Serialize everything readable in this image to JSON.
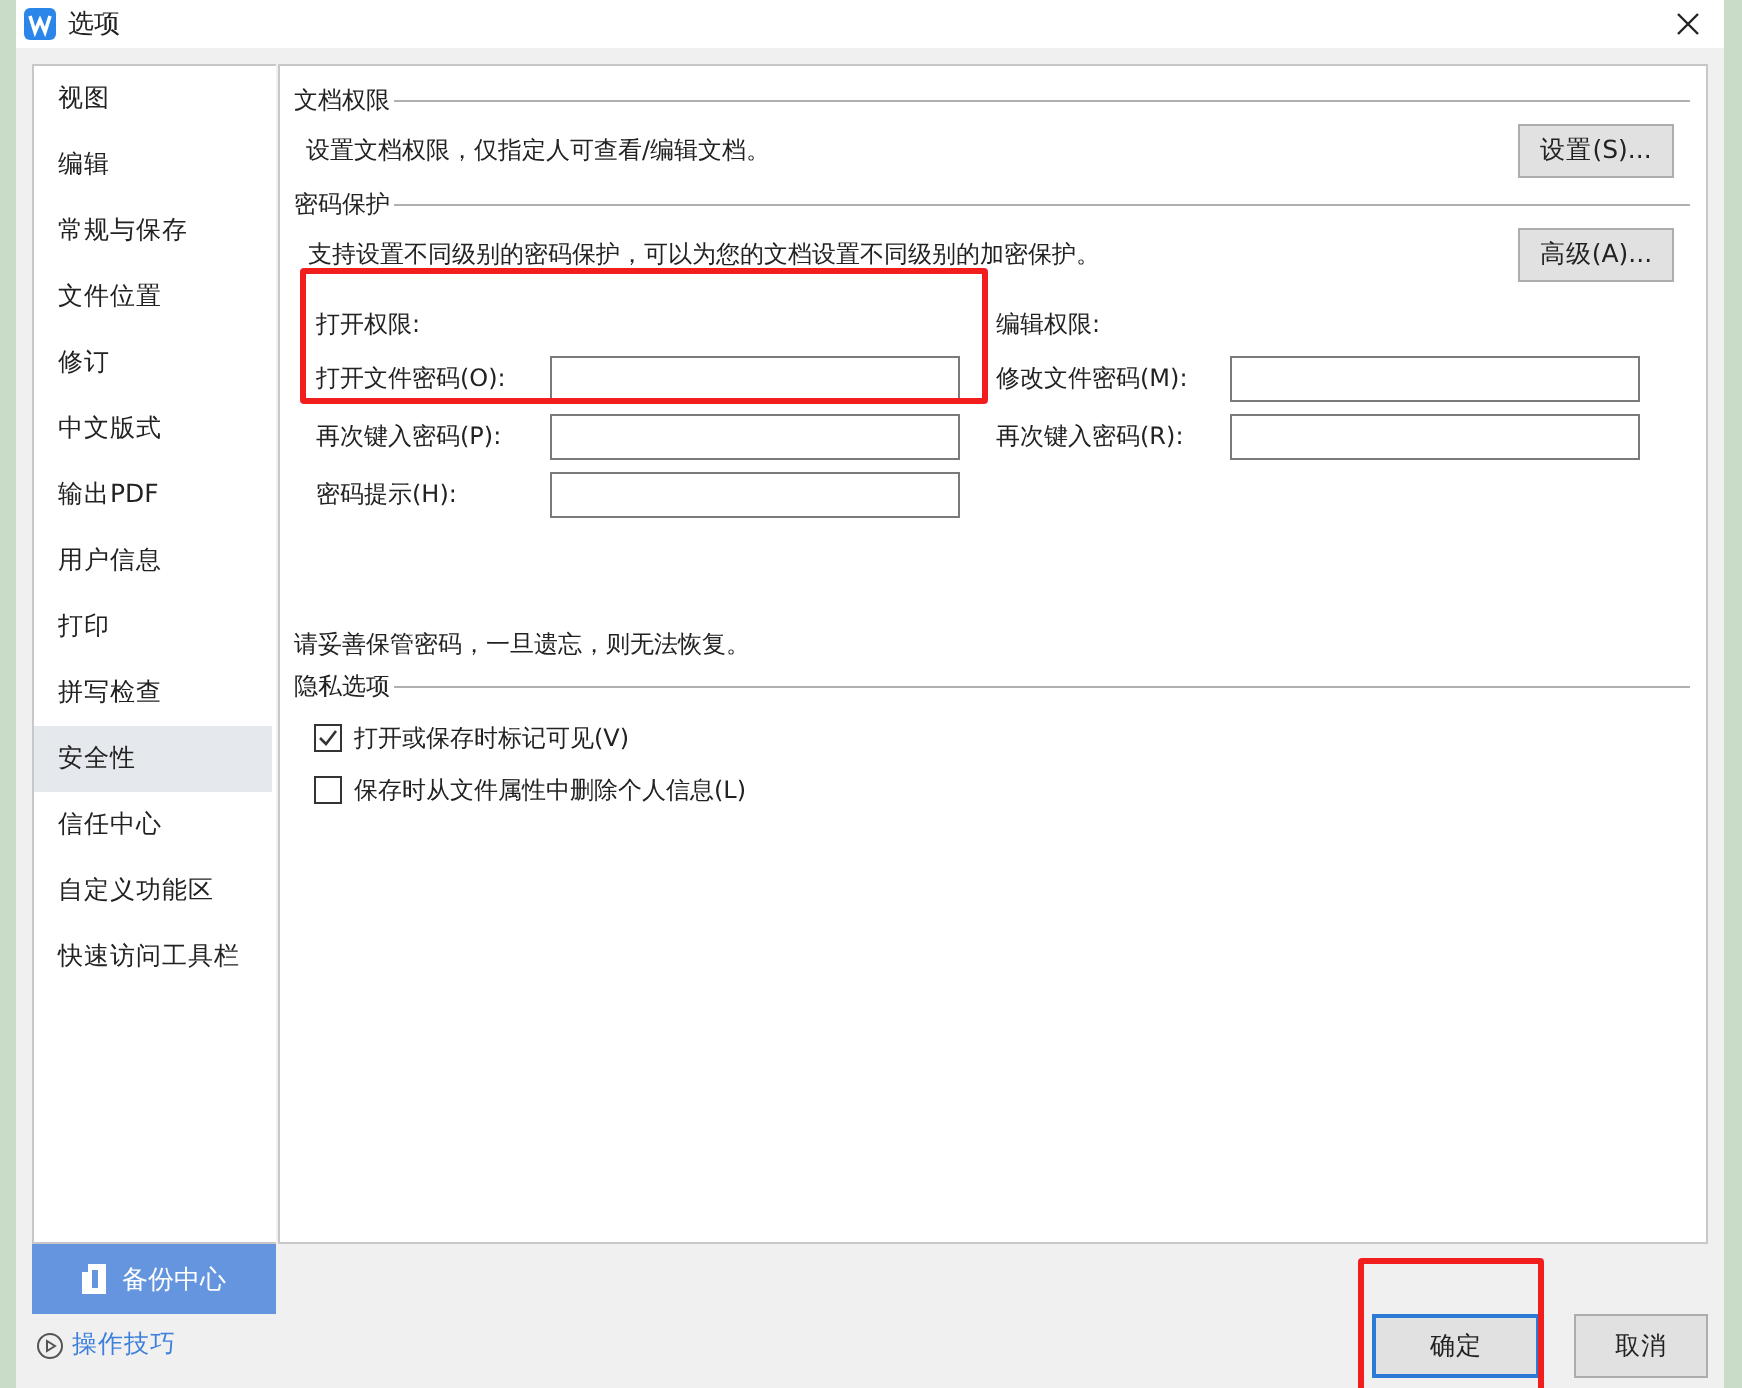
{
  "window": {
    "title": "选项"
  },
  "sidebar": {
    "items": [
      {
        "label": "视图",
        "selected": false
      },
      {
        "label": "编辑",
        "selected": false
      },
      {
        "label": "常规与保存",
        "selected": false
      },
      {
        "label": "文件位置",
        "selected": false
      },
      {
        "label": "修订",
        "selected": false
      },
      {
        "label": "中文版式",
        "selected": false
      },
      {
        "label": "输出PDF",
        "selected": false
      },
      {
        "label": "用户信息",
        "selected": false
      },
      {
        "label": "打印",
        "selected": false
      },
      {
        "label": "拼写检查",
        "selected": false
      },
      {
        "label": "安全性",
        "selected": true
      },
      {
        "label": "信任中心",
        "selected": false
      },
      {
        "label": "自定义功能区",
        "selected": false
      },
      {
        "label": "快速访问工具栏",
        "selected": false
      }
    ],
    "backup_button": "备份中心",
    "tips_link": "操作技巧"
  },
  "document_permission": {
    "heading": "文档权限",
    "description": "设置文档权限，仅指定人可查看/编辑文档。",
    "button": "设置(S)..."
  },
  "password_protection": {
    "heading": "密码保护",
    "description": "支持设置不同级别的密码保护，可以为您的文档设置不同级别的加密保护。",
    "button": "高级(A)...",
    "groups": [
      {
        "title": "打开权限:",
        "highlighted": true,
        "fields": [
          {
            "label": "打开文件密码(O):"
          },
          {
            "label": "再次键入密码(P):"
          },
          {
            "label": "密码提示(H):"
          }
        ]
      },
      {
        "title": "编辑权限:",
        "highlighted": false,
        "fields": [
          {
            "label": "修改文件密码(M):"
          },
          {
            "label": "再次键入密码(R):"
          }
        ]
      }
    ],
    "note": "请妥善保管密码，一旦遗忘，则无法恢复。"
  },
  "privacy": {
    "heading": "隐私选项",
    "options": [
      {
        "label": "打开或保存时标记可见(V)",
        "checked": true
      },
      {
        "label": "保存时从文件属性中删除个人信息(L)",
        "checked": false
      }
    ]
  },
  "buttons": [
    {
      "label": "确定",
      "focused": true,
      "highlighted": true
    },
    {
      "label": "取消",
      "focused": false,
      "highlighted": false
    }
  ]
}
